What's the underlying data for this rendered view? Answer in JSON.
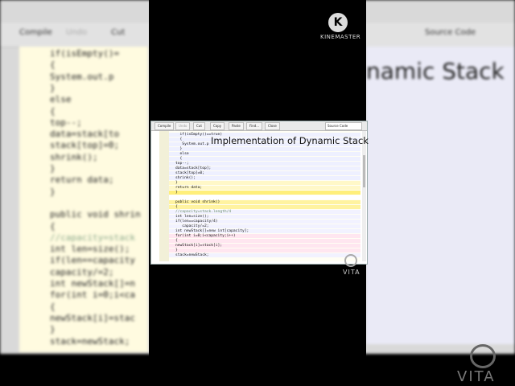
{
  "watermarks": {
    "kinemaster": "KINEMASTER",
    "kinemaster_logo_letter": "K",
    "vita_small": "VITA",
    "vita_big": "VITA"
  },
  "background": {
    "toolbar": [
      "Compile",
      "Undo",
      "Cut",
      "Source Code"
    ],
    "title": "namic Stack",
    "code_lines": [
      "if(isEmpty()=",
      "{",
      "  System.out.p",
      "}",
      "  else",
      "  {",
      "top--;",
      "data=stack[to",
      "stack[top]=0;",
      "shrink();",
      "}",
      "return data;",
      "}",
      "",
      "public void shrin",
      "{",
      "//capacity=stack",
      "int len=size();",
      "if(len==capacity",
      "  capacity/=2;",
      "int newStack[]=n",
      "for(int i=0;i<ca",
      "{",
      "newStack[i]=stac",
      "}",
      "stack=newStack;"
    ]
  },
  "editor": {
    "toolbar": {
      "compile": "Compile",
      "undo": "Undo",
      "cut": "Cut",
      "copy": "Copy",
      "paste": "Paste",
      "find": "Find...",
      "close": "Close",
      "view_select": "Source Code"
    },
    "overlay_title": "Implementation of Dynamic Stack",
    "code_lines": [
      "  if(isEmpty()==true)",
      "  {",
      "   System.out.p",
      "  }",
      "  else",
      "  {",
      "top--;",
      "data=stack[top];",
      "stack[top]=0;",
      "shrink();",
      "}",
      "return data;",
      "}",
      "",
      "public void shrink()",
      "{",
      "//capacity=stack.length/4",
      "int len=size();",
      "if(len==capacity/4)",
      "   capacity/=2;",
      "int newStack[]=new int[capacity];",
      "for(int i=0;i<capacity;i++)",
      "{",
      "newStack[i]=stack[i];",
      "}",
      "stack=newStack;"
    ],
    "row_colors": [
      "#eef0ff",
      "#eef0ff",
      "#eef0ff",
      "#eef0ff",
      "#eef0ff",
      "#eef0ff",
      "#eef0ff",
      "#eef0ff",
      "#eef0ff",
      "#eef0ff",
      "#fff8c8",
      "#fff8c8",
      "#ffef7a",
      "#ffffff",
      "#fff3a0",
      "#fff3a0",
      "#f2f2ff",
      "#f2f2ff",
      "#f2f2ff",
      "#f2f2ff",
      "#f2f2ff",
      "#ffe6f0",
      "#ffe6f0",
      "#ffe6f0",
      "#ffe6f0",
      "#f2f2ff"
    ]
  }
}
